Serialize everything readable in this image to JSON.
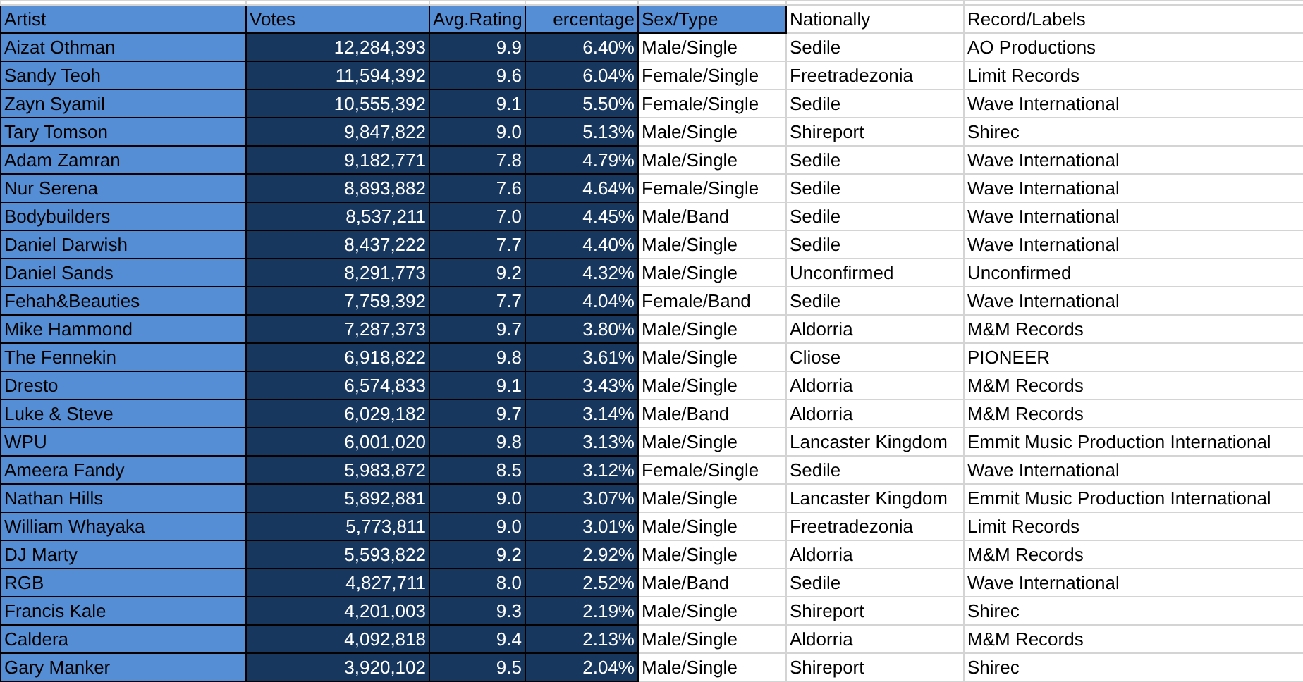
{
  "columns": [
    {
      "header": "Artist",
      "kind": "light"
    },
    {
      "header": "Votes",
      "kind": "dark",
      "header_highlighted": true,
      "header_right_aligned": false
    },
    {
      "header": "Avg.Rating",
      "kind": "dark",
      "header_highlighted": true,
      "header_right_aligned": true
    },
    {
      "header": "ercentage",
      "kind": "dark",
      "header_highlighted": true,
      "header_right_aligned": true
    },
    {
      "header": "Sex/Type",
      "kind": "plain",
      "header_highlighted": true
    },
    {
      "header": "Nationally",
      "kind": "plain",
      "header_highlighted": false
    },
    {
      "header": "Record/Labels",
      "kind": "plain",
      "header_highlighted": false
    }
  ],
  "rows": [
    [
      "Aizat Othman",
      "12,284,393",
      "9.9",
      "6.40%",
      "Male/Single",
      "Sedile",
      "AO Productions"
    ],
    [
      "Sandy Teoh",
      "11,594,392",
      "9.6",
      "6.04%",
      "Female/Single",
      "Freetradezonia",
      "Limit Records"
    ],
    [
      "Zayn Syamil",
      "10,555,392",
      "9.1",
      "5.50%",
      "Female/Single",
      "Sedile",
      "Wave International"
    ],
    [
      "Tary Tomson",
      "9,847,822",
      "9.0",
      "5.13%",
      "Male/Single",
      "Shireport",
      "Shirec"
    ],
    [
      "Adam Zamran",
      "9,182,771",
      "7.8",
      "4.79%",
      "Male/Single",
      "Sedile",
      "Wave International"
    ],
    [
      "Nur Serena",
      "8,893,882",
      "7.6",
      "4.64%",
      "Female/Single",
      "Sedile",
      "Wave International"
    ],
    [
      "Bodybuilders",
      "8,537,211",
      "7.0",
      "4.45%",
      "Male/Band",
      "Sedile",
      "Wave International"
    ],
    [
      "Daniel Darwish",
      "8,437,222",
      "7.7",
      "4.40%",
      "Male/Single",
      "Sedile",
      "Wave International"
    ],
    [
      "Daniel Sands",
      "8,291,773",
      "9.2",
      "4.32%",
      "Male/Single",
      "Unconfirmed",
      "Unconfirmed"
    ],
    [
      "Fehah&Beauties",
      "7,759,392",
      "7.7",
      "4.04%",
      "Female/Band",
      "Sedile",
      "Wave International"
    ],
    [
      "Mike Hammond",
      "7,287,373",
      "9.7",
      "3.80%",
      "Male/Single",
      "Aldorria",
      "M&M Records"
    ],
    [
      "The Fennekin",
      "6,918,822",
      "9.8",
      "3.61%",
      "Male/Single",
      "Cliose",
      "PIONEER"
    ],
    [
      "Dresto",
      "6,574,833",
      "9.1",
      "3.43%",
      "Male/Single",
      "Aldorria",
      "M&M Records"
    ],
    [
      "Luke & Steve",
      "6,029,182",
      "9.7",
      "3.14%",
      "Male/Band",
      "Aldorria",
      "M&M Records"
    ],
    [
      "WPU",
      "6,001,020",
      "9.8",
      "3.13%",
      "Male/Single",
      "Lancaster Kingdom",
      "Emmit Music Production International"
    ],
    [
      "Ameera Fandy",
      "5,983,872",
      "8.5",
      "3.12%",
      "Female/Single",
      "Sedile",
      "Wave International"
    ],
    [
      "Nathan Hills",
      "5,892,881",
      "9.0",
      "3.07%",
      "Male/Single",
      "Lancaster Kingdom",
      "Emmit Music Production International"
    ],
    [
      "William Whayaka",
      "5,773,811",
      "9.0",
      "3.01%",
      "Male/Single",
      "Freetradezonia",
      "Limit Records"
    ],
    [
      "DJ Marty",
      "5,593,822",
      "9.2",
      "2.92%",
      "Male/Single",
      "Aldorria",
      "M&M Records"
    ],
    [
      "RGB",
      "4,827,711",
      "8.0",
      "2.52%",
      "Male/Band",
      "Sedile",
      "Wave International"
    ],
    [
      "Francis Kale",
      "4,201,003",
      "9.3",
      "2.19%",
      "Male/Single",
      "Shireport",
      "Shirec"
    ],
    [
      "Caldera",
      "4,092,818",
      "9.4",
      "2.13%",
      "Male/Single",
      "Aldorria",
      "M&M Records"
    ],
    [
      "Gary Manker",
      "3,920,102",
      "9.5",
      "2.04%",
      "Male/Single",
      "Shireport",
      "Shirec"
    ]
  ]
}
